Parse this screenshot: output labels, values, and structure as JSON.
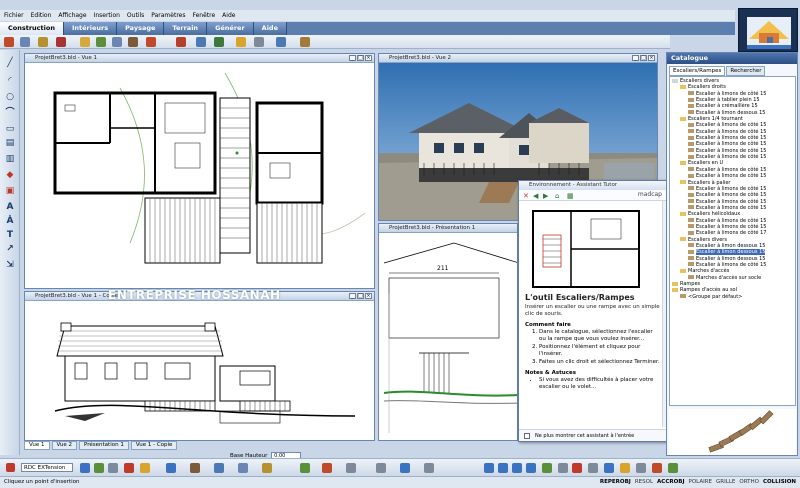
{
  "menu": [
    "Fichier",
    "Edition",
    "Affichage",
    "Insertion",
    "Outils",
    "Paramètres",
    "Fenêtre",
    "Aide"
  ],
  "tabs": [
    "Construction",
    "Intérieurs",
    "Paysage",
    "Terrain",
    "Générer",
    "Aide"
  ],
  "views": {
    "v1": {
      "title": "ProjetBret3.bld - Vue 1"
    },
    "v2": {
      "title": "ProjetBret3.bld - Vue 2"
    },
    "v3": {
      "title": "ProjetBret3.bld - Vue 1 - Copie"
    },
    "v4": {
      "title": "ProjetBret3.bld - Présentation 1"
    }
  },
  "dimension_label": "211",
  "view_tabs": [
    "Vue 1",
    "Vue 2",
    "Présentation 1",
    "Vue 1 - Copie"
  ],
  "base_hauteur": {
    "label": "Base Hauteur",
    "value": "0.00"
  },
  "layer_select": "RDC EXTension",
  "watermark": "ENTREPRISE HOSSANAH",
  "catalog": {
    "title": "Catalogue",
    "tabs": [
      "Escaliers/Rampes",
      "Rechercher"
    ],
    "tree": [
      {
        "label": "Escaliers divers",
        "level": 0,
        "type": "root"
      },
      {
        "label": "Escaliers droits",
        "level": 1,
        "type": "folder"
      },
      {
        "label": "Escalier à limons de côté 15",
        "level": 2,
        "type": "item"
      },
      {
        "label": "Escalier à tablier plein 15",
        "level": 2,
        "type": "item"
      },
      {
        "label": "Escalier à crémaillère 15",
        "level": 2,
        "type": "item"
      },
      {
        "label": "Escalier à limon dessous 15",
        "level": 2,
        "type": "item"
      },
      {
        "label": "Escaliers 1/4 tournant",
        "level": 1,
        "type": "folder"
      },
      {
        "label": "Escalier à limons de côté 15",
        "level": 2,
        "type": "item"
      },
      {
        "label": "Escalier à limons de côté 15",
        "level": 2,
        "type": "item"
      },
      {
        "label": "Escalier à limons de côté 15",
        "level": 2,
        "type": "item"
      },
      {
        "label": "Escalier à limons de côté 15",
        "level": 2,
        "type": "item"
      },
      {
        "label": "Escalier à limons de côté 15",
        "level": 2,
        "type": "item"
      },
      {
        "label": "Escalier à limons de côté 15",
        "level": 2,
        "type": "item"
      },
      {
        "label": "Escaliers en U",
        "level": 1,
        "type": "folder"
      },
      {
        "label": "Escalier à limons de côté 15",
        "level": 2,
        "type": "item"
      },
      {
        "label": "Escalier à limons de côté 15",
        "level": 2,
        "type": "item"
      },
      {
        "label": "Escaliers à palier",
        "level": 1,
        "type": "folder"
      },
      {
        "label": "Escalier à limons de côté 15",
        "level": 2,
        "type": "item"
      },
      {
        "label": "Escalier à limons de côté 15",
        "level": 2,
        "type": "item"
      },
      {
        "label": "Escalier à limons de côté 15",
        "level": 2,
        "type": "item"
      },
      {
        "label": "Escalier à limons de côté 15",
        "level": 2,
        "type": "item"
      },
      {
        "label": "Escaliers hélicoïdaux",
        "level": 1,
        "type": "folder"
      },
      {
        "label": "Escalier à limons de côté 15",
        "level": 2,
        "type": "item"
      },
      {
        "label": "Escalier à limons de côté 15",
        "level": 2,
        "type": "item"
      },
      {
        "label": "Escalier à limons de côté 17",
        "level": 2,
        "type": "item"
      },
      {
        "label": "Escaliers divers",
        "level": 1,
        "type": "folder"
      },
      {
        "label": "Escalier à limon dessous 15",
        "level": 2,
        "type": "item"
      },
      {
        "label": "Escalier à limon dessous 15",
        "level": 2,
        "type": "item",
        "selected": true
      },
      {
        "label": "Escalier à limon dessous 15",
        "level": 2,
        "type": "item"
      },
      {
        "label": "Escalier à limons de côté 15",
        "level": 2,
        "type": "item"
      },
      {
        "label": "Marches d'accès",
        "level": 1,
        "type": "folder"
      },
      {
        "label": "Marches d'accès sur socle",
        "level": 2,
        "type": "item"
      },
      {
        "label": "Rampes",
        "level": 0,
        "type": "folder"
      },
      {
        "label": "Rampes d'accès au sol",
        "level": 0,
        "type": "folder"
      },
      {
        "label": "<Groupe par défaut>",
        "level": 1,
        "type": "item"
      }
    ]
  },
  "assistant": {
    "title": "Environnement - Assistant Tutor",
    "brand": "madcap",
    "heading": "L'outil Escaliers/Rampes",
    "intro": "Insérer un escalier ou une rampe avec un simple clic de souris.",
    "how_to_label": "Comment faire",
    "steps": [
      "Dans le catalogue, sélectionnez l'escalier ou la rampe que vous voulez insérer...",
      "Positionnez l'élément et cliquez pour l'insérer.",
      "Faites un clic droit et sélectionnez Terminer."
    ],
    "notes_label": "Notes & Astuces",
    "notes": [
      "Si vous avez des difficultés à placer votre escalier ou le volet..."
    ],
    "footer_check": "Ne plus montrer cet assistant à l'entrée"
  },
  "status": {
    "text": "Cliquez un point d'insertion",
    "modes": [
      "REPEROBJ",
      "RESOL",
      "ACCROBJ",
      "POLAIRE",
      "GRILLE",
      "ORTHO",
      "COLLISION"
    ]
  },
  "colors": {
    "accent": "#2c4f85",
    "tab_bg": "#5c7fb0",
    "selection": "#3d6ab3",
    "deck": "#9b7a55"
  }
}
